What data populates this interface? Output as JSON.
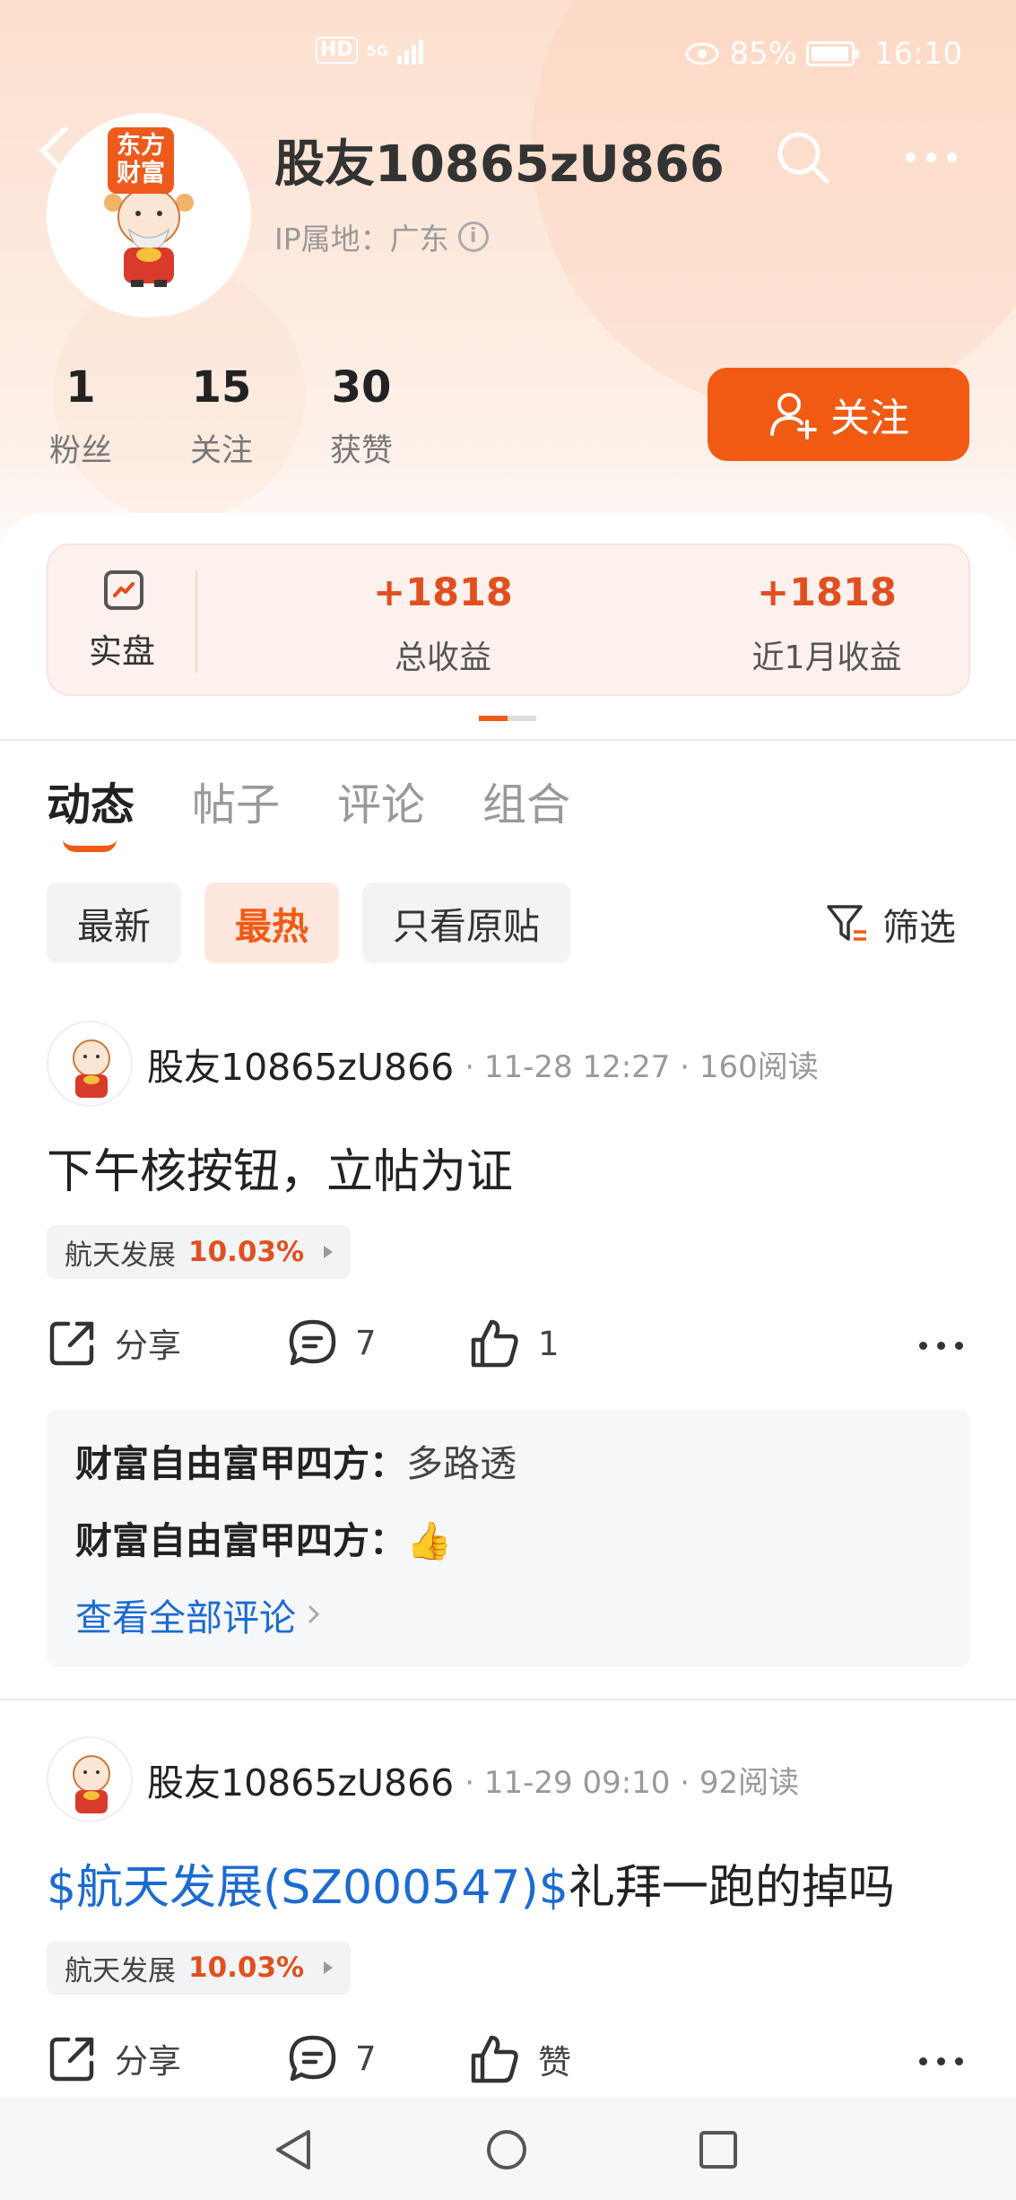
{
  "status_bar": {
    "network": "HD",
    "signal": "5G",
    "battery": "85%",
    "time": "16:10"
  },
  "profile": {
    "username": "股友10865zU866",
    "ip_location": "IP属地：广东",
    "logo_text": "东方财富",
    "stats": [
      {
        "value": "1",
        "label": "粉丝"
      },
      {
        "value": "15",
        "label": "关注"
      },
      {
        "value": "30",
        "label": "获赞"
      }
    ],
    "follow_label": "关注"
  },
  "earnings": {
    "badge_label": "实盘",
    "total": {
      "value": "+1818",
      "label": "总收益"
    },
    "month": {
      "value": "+1818",
      "label": "近1月收益"
    }
  },
  "tabs": [
    "动态",
    "帖子",
    "评论",
    "组合"
  ],
  "filters": {
    "chips": [
      "最新",
      "最热",
      "只看原贴"
    ],
    "active": "最热",
    "filter_label": "筛选"
  },
  "posts": [
    {
      "author": "股友10865zU866",
      "meta": "· 11-28 12:27 · 160阅读",
      "text": "下午核按钮，立帖为证",
      "stock": {
        "name": "航天发展",
        "change": "10.03%"
      },
      "share_label": "分享",
      "comment_count": "7",
      "like_label": "1",
      "comments": [
        {
          "user": "财富自由富甲四方：",
          "text": "多路透"
        },
        {
          "user": "财富自由富甲四方：",
          "text": "👍"
        }
      ],
      "view_all": "查看全部评论"
    },
    {
      "author": "股友10865zU866",
      "meta": "· 11-29 09:10 · 92阅读",
      "text_link": "$航天发展(SZ000547)$",
      "text": "礼拜一跑的掉吗",
      "stock": {
        "name": "航天发展",
        "change": "10.03%"
      },
      "share_label": "分享",
      "comment_count": "7",
      "like_label": "赞"
    }
  ],
  "colors": {
    "accent": "#f15a13",
    "profit": "#e0501f",
    "link": "#1b6bd1"
  }
}
